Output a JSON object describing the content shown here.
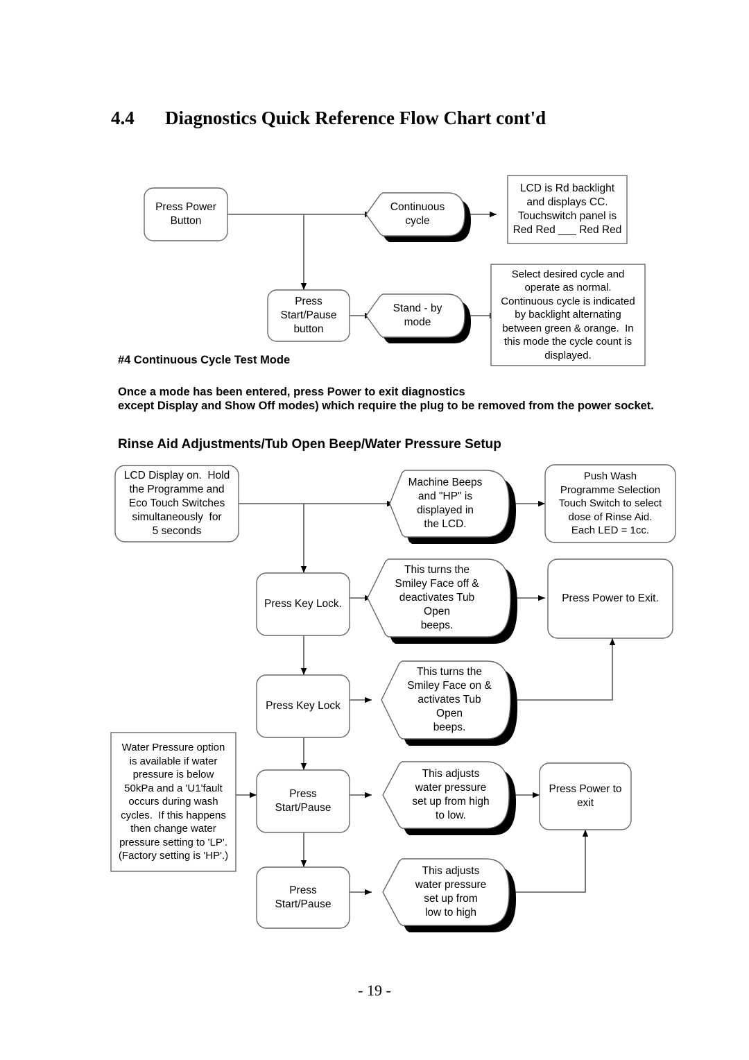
{
  "document": {
    "section_number": "4.4",
    "title": "Diagnostics Quick Reference Flow Chart cont'd",
    "page_footer": "- 19 -"
  },
  "notes": {
    "mode_label": "#4 Continuous Cycle Test Mode",
    "exit_line1": "Once a mode has been entered, press Power to exit diagnostics",
    "exit_line2": "except Display and Show Off modes) which require the plug to be removed from the power socket.",
    "section_heading": "Rinse Aid Adjustments/Tub Open Beep/Water Pressure Setup"
  },
  "chart_top": {
    "n1": "Press Power\nButton",
    "n2": "Continuous\ncycle",
    "n3": "LCD is Rd backlight\nand displays CC.\nTouchswitch panel is\nRed Red ___ Red Red",
    "n4": "Press\nStart/Pause\nbutton",
    "n5": "Stand - by\nmode",
    "n6": "Select desired cycle and\noperate as normal.\nContinuous cycle is indicated\nby backlight alternating\nbetween green & orange.  In\nthis mode the cycle count is\ndisplayed."
  },
  "chart_bottom": {
    "b1": "LCD Display on.  Hold\nthe Programme and\nEco Touch Switches\nsimultaneously  for\n5 seconds",
    "b2": "Machine Beeps\nand \"HP\" is\ndisplayed in\nthe LCD.",
    "b3": "Push Wash\nProgramme Selection\nTouch Switch to select\ndose of Rinse Aid.\nEach LED = 1cc.",
    "b4": "Press Key Lock.",
    "b5": "This turns the\nSmiley Face off &\ndeactivates Tub\nOpen\nbeeps.",
    "b6": "Press Power to Exit.",
    "b7": "Press Key Lock",
    "b8": "This turns the\nSmiley Face on &\nactivates Tub\nOpen\nbeeps.",
    "b9": "Water Pressure option\nis available if water\npressure is below\n50kPa and a 'U1'fault\noccurs during wash\ncycles.  If this happens\nthen change water\npressure setting to 'LP'.\n(Factory setting is 'HP'.)",
    "b10": "Press\nStart/Pause",
    "b11": "This adjusts\nwater pressure\nset up from high\nto low.",
    "b12": "Press Power to\nexit",
    "b13": "Press\nStart/Pause",
    "b14": "This adjusts\nwater pressure\nset up from\nlow to high"
  },
  "colors": {
    "stroke": "#555555",
    "shape_stroke": "#444444",
    "shadow": "#000000",
    "text": "#000000",
    "background": "#ffffff"
  }
}
